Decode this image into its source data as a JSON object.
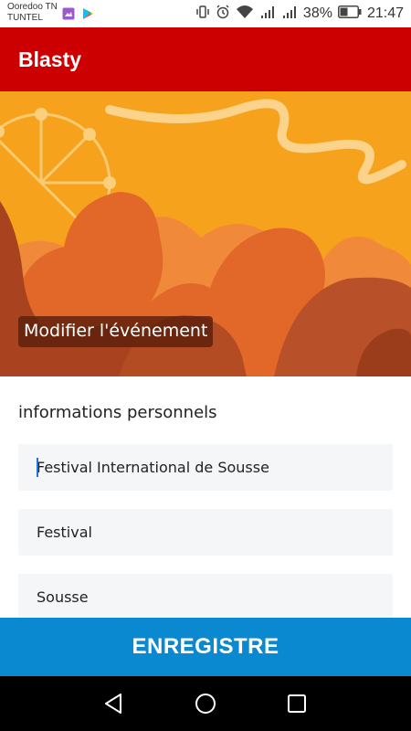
{
  "status_bar": {
    "carrier_line1": "Ooredoo TN",
    "carrier_line2": "TUNTEL",
    "battery": "38%",
    "time": "21:47",
    "icons": [
      "gallery-icon",
      "play-store-icon",
      "vibrate-icon",
      "alarm-icon",
      "wifi-icon",
      "signal-icon",
      "signal-icon",
      "battery-icon"
    ]
  },
  "app_bar": {
    "title": "Blasty"
  },
  "banner": {
    "caption": "Modifier l'événement",
    "colors": {
      "background": "#f6a21c",
      "crowd_front": "#a9421e",
      "crowd_mid": "#e2682a",
      "crowd_back": "#f08a3a"
    }
  },
  "form": {
    "section_title": "informations personnels",
    "fields": [
      {
        "value": "Festival International de Sousse"
      },
      {
        "value": "Festival"
      },
      {
        "value": "Sousse"
      }
    ]
  },
  "save_button": {
    "label": "ENREGISTRE"
  },
  "nav_bar": {
    "buttons": [
      "back-icon",
      "home-icon",
      "recents-icon"
    ]
  },
  "colors": {
    "app_bar": "#cc0000",
    "save_button": "#0a88d0"
  }
}
